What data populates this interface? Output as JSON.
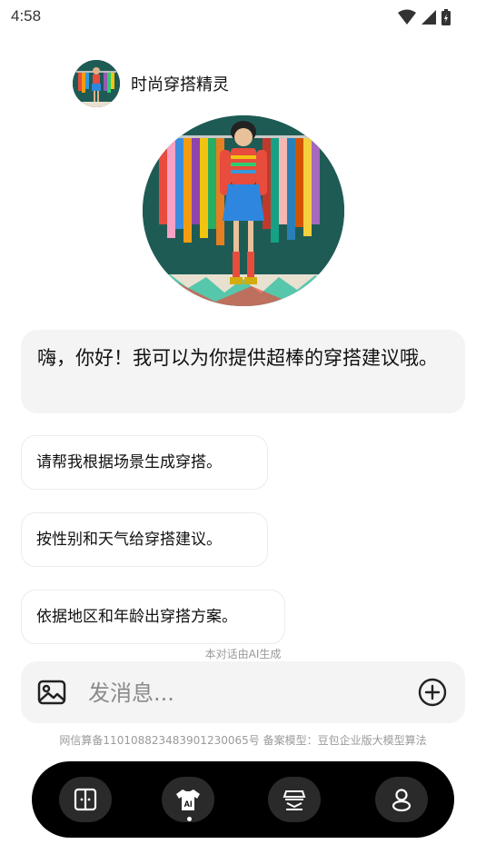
{
  "status": {
    "time": "4:58"
  },
  "header": {
    "agent_name": "时尚穿搭精灵"
  },
  "chat": {
    "greeting": "嗨，你好！我可以为你提供超棒的穿搭建议哦。",
    "suggestions": [
      "请帮我根据场景生成穿搭。",
      "按性别和天气给穿搭建议。",
      "依据地区和年龄出穿搭方案。"
    ],
    "ai_note": "本对话由AI生成"
  },
  "input": {
    "placeholder": "发消息..."
  },
  "footer": {
    "note": "网信算备110108823483901230065号 备案模型：豆包企业版大模型算法"
  },
  "tabbar": {
    "tabs": [
      {
        "icon": "book-icon"
      },
      {
        "icon": "ai-shirt-icon",
        "label": "AI"
      },
      {
        "icon": "wardrobe-icon"
      },
      {
        "icon": "profile-icon"
      }
    ]
  }
}
